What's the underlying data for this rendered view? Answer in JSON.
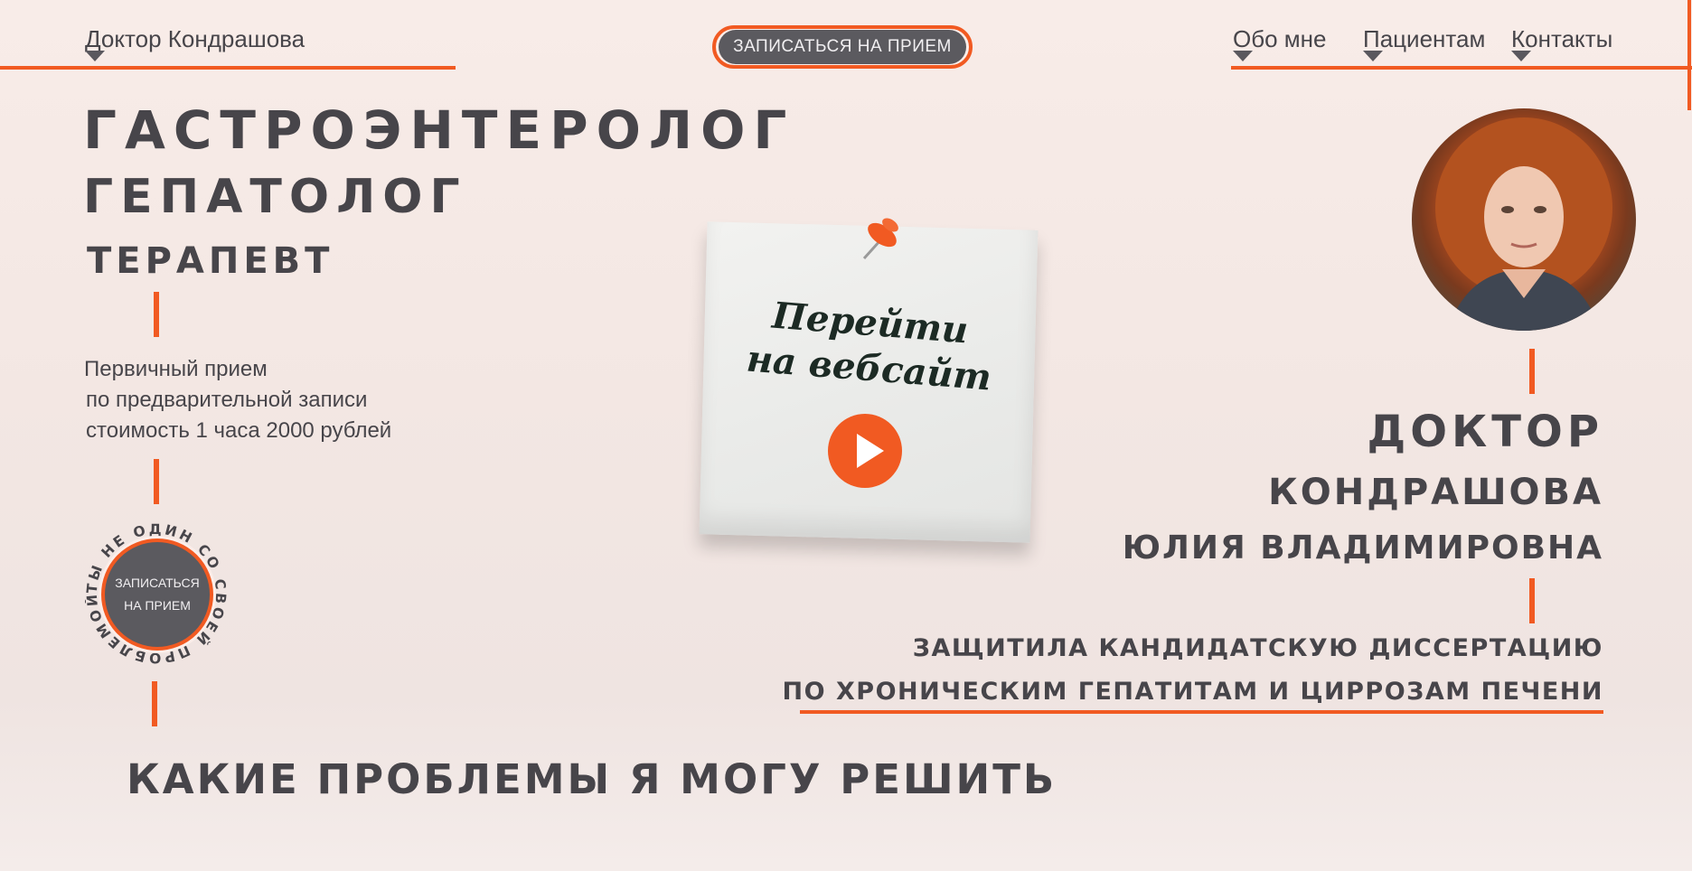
{
  "header": {
    "brand": "Доктор Кондрашова",
    "cta_button": "ЗАПИСАТЬСЯ НА ПРИЕМ",
    "nav": [
      {
        "label": "Обо мне"
      },
      {
        "label": "Пациентам"
      },
      {
        "label": "Контакты"
      }
    ]
  },
  "specialties": {
    "line1": "ГАСТРОЭНТЕРОЛОГ",
    "line2": "ГЕПАТОЛОГ",
    "line3": "ТЕРАПЕВТ"
  },
  "appointment_info": {
    "line1": "Первичный прием",
    "line2": "по предварительной записи",
    "line3": "стоимость 1 часа 2000 рублей"
  },
  "stamp": {
    "circle_text": "ТЫ НЕ ОДИН СО СВОЕЙ ПРОБЛЕМОЙ •",
    "button_line1": "ЗАПИСАТЬСЯ",
    "button_line2": "НА ПРИЕМ"
  },
  "sticky_note": {
    "line1": "Перейти",
    "line2": "на вебсайт"
  },
  "doctor": {
    "title": "ДОКТОР",
    "surname": "КОНДРАШОВА",
    "name": "ЮЛИЯ ВЛАДИМИРОВНА",
    "credential_line1": "ЗАЩИТИЛА КАНДИДАТСКУЮ ДИССЕРТАЦИЮ",
    "credential_line2": "ПО ХРОНИЧЕСКИМ ГЕПАТИТАМ И ЦИРРОЗАМ ПЕЧЕНИ"
  },
  "section": {
    "title": "КАКИЕ ПРОБЛЕМЫ Я МОГУ РЕШИТЬ"
  },
  "colors": {
    "accent": "#f15a22",
    "text": "#47454a",
    "button": "#5b5a5f"
  }
}
